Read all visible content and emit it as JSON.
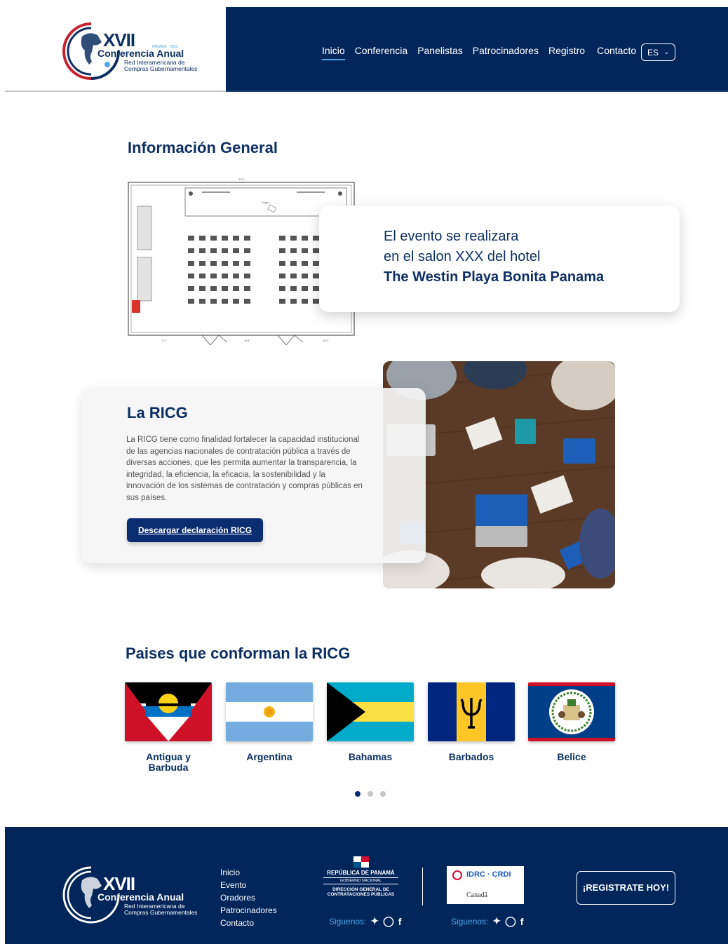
{
  "header": {
    "logo": {
      "numeral": "XVII",
      "title": "Conferencia Anual",
      "subtitle_line1": "Red Interamericana de",
      "subtitle_line2": "Compras Gubernamentales",
      "tiny": "PANAMÁ · 2022"
    },
    "nav": [
      {
        "label": "Inicio",
        "active": true
      },
      {
        "label": "Conferencia"
      },
      {
        "label": "Panelistas"
      },
      {
        "label": "Patrocinadores"
      },
      {
        "label": "Registro"
      },
      {
        "label": "Contacto"
      }
    ],
    "language": "ES"
  },
  "info": {
    "title": "Información General",
    "line1": "El evento se realizara",
    "line2": "en el salon XXX del hotel",
    "line3": "The Westin Playa Bonita Panama"
  },
  "ricg": {
    "title": "La RICG",
    "body": "La RICG tiene como finalidad fortalecer la capacidad institucional de las agencias nacionales de contratación pública a través de diversas acciones, que les permita aumentar la transparencia, la integridad, la eficiencia, la eficacia, la sostenibilidad y la innovación de los sistemas de contratación y compras públicas en sus países.",
    "button": "Descargar declaración RICG"
  },
  "countries": {
    "title": "Paises que conforman la RICG",
    "items": [
      {
        "name": "Antigua y Barbuda"
      },
      {
        "name": "Argentina"
      },
      {
        "name": "Bahamas"
      },
      {
        "name": "Barbados"
      },
      {
        "name": "Belice"
      }
    ],
    "page": 1,
    "pages": 3
  },
  "footer": {
    "links": [
      "Inicio",
      "Evento",
      "Oradores",
      "Patrocinadores",
      "Contacto"
    ],
    "panama": {
      "line1": "REPÚBLICA DE PANAMÁ",
      "line2": "GOBIERNO NACIONAL",
      "line3": "DIRECCIÓN GENERAL DE",
      "line4": "CONTRATACIONES PÚBLICAS"
    },
    "idrc": {
      "name": "IDRC · CRDI",
      "country": "Canadä"
    },
    "follow_label": "Siguenos:",
    "register_button": "¡REGISTRATE HOY!"
  },
  "colors": {
    "navy": "#02255a",
    "accent": "#4da6e8",
    "red": "#c8202f"
  }
}
